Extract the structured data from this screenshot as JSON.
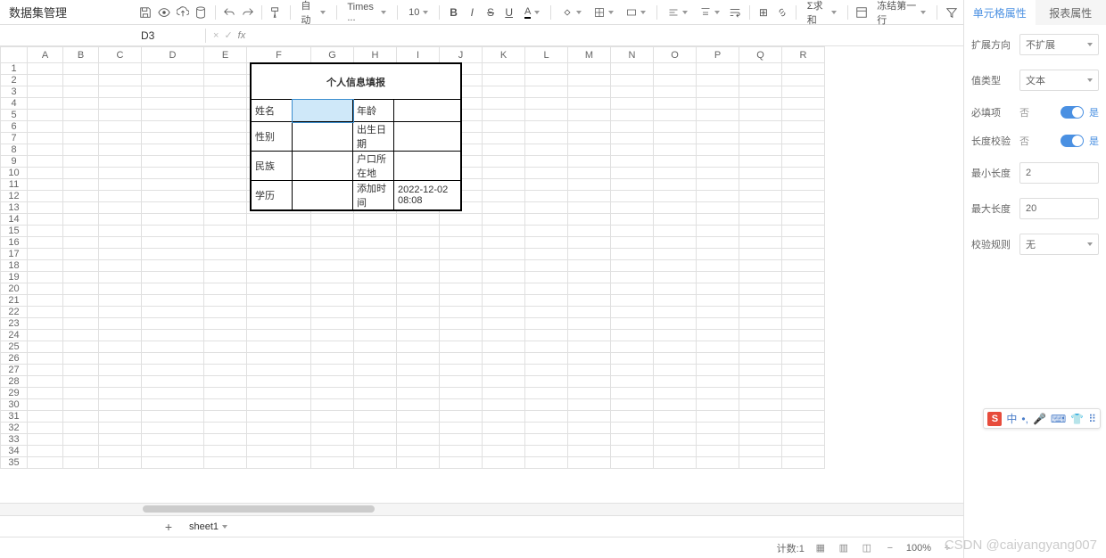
{
  "app_title": "数据集管理",
  "toolbar": {
    "auto": "自动",
    "font": "Times ...",
    "size": "10",
    "sum": "Σ求和",
    "freeze": "冻结第一行"
  },
  "cell_ref": "D3",
  "columns": [
    "A",
    "B",
    "C",
    "D",
    "E",
    "F",
    "G",
    "H",
    "I",
    "J",
    "K",
    "L",
    "M",
    "N",
    "O",
    "P",
    "Q",
    "R"
  ],
  "rows_count": 35,
  "selected_cell": {
    "row": 3,
    "col": "D"
  },
  "form": {
    "title": "个人信息填报",
    "rows": [
      {
        "l1": "姓名",
        "v1": "",
        "l2": "年龄",
        "v2": ""
      },
      {
        "l1": "性别",
        "v1": "",
        "l2": "出生日期",
        "v2": ""
      },
      {
        "l1": "民族",
        "v1": "",
        "l2": "户口所在地",
        "v2": ""
      },
      {
        "l1": "学历",
        "v1": "",
        "l2": "添加时间",
        "v2": "2022-12-02 08:08"
      }
    ]
  },
  "sheet_tab": "sheet1",
  "status": {
    "count": "计数:1",
    "zoom": "100%"
  },
  "right": {
    "tab_cell": "单元格属性",
    "tab_report": "报表属性",
    "expand_label": "扩展方向",
    "expand_value": "不扩展",
    "valtype_label": "值类型",
    "valtype_value": "文本",
    "required_label": "必填项",
    "no": "否",
    "yes": "是",
    "lencheck_label": "长度校验",
    "minlen_label": "最小长度",
    "minlen_value": "2",
    "maxlen_label": "最大长度",
    "maxlen_value": "20",
    "rule_label": "校验规则",
    "rule_value": "无"
  },
  "ime": {
    "s": "S",
    "zh": "中"
  },
  "watermark": "CSDN @caiyangyang007"
}
